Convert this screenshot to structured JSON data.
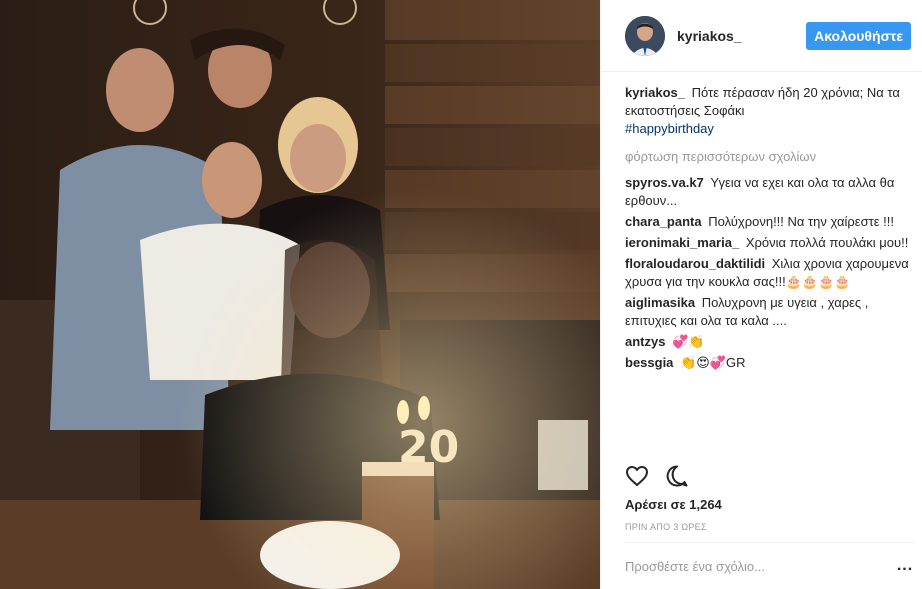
{
  "post": {
    "username": "kyriakos_",
    "follow_label": "Ακολουθήστε",
    "caption_user": "kyriakos_",
    "caption_text": "Πότε πέρασαν ήδη 20 χρόνια; Να τα εκατοστήσεις Σοφάκι",
    "caption_hashtag": "#happybirthday",
    "load_more": "φόρτωση περισσότερων σχολίων",
    "likes": "Αρέσει σε 1,264",
    "timestamp": "ΠΡΙΝ ΑΠΟ 3 ΩΡΕΣ",
    "comment_placeholder": "Προσθέστε ένα σχόλιο...",
    "more_label": "..."
  },
  "comments": [
    {
      "user": "spyros.va.k7",
      "text": "Υγεια να εχει και ολα τα αλλα θα ερθουν..."
    },
    {
      "user": "chara_panta",
      "text": "Πολύχρονη!!! Να την χαίρεστε !!!"
    },
    {
      "user": "ieronimaki_maria_",
      "text": "Χρόνια πολλά πουλάκι μου!!"
    },
    {
      "user": "floraloudarou_daktilidi",
      "text": "Χιλια χρονια χαρουμενα χρυσα για την κουκλα σας!!!🎂🎂🎂🎂"
    },
    {
      "user": "aiglimasika",
      "text": "Πολυχρονη με υγεια , χαρες , επιτυχιες και ολα τα καλα ...."
    },
    {
      "user": "antzys",
      "text": "💞👏"
    },
    {
      "user": "bessgia",
      "text": "👏😍💞GR"
    }
  ],
  "icons": {
    "like": "heart-icon",
    "comment": "comment-bubble-icon",
    "more": "more-options-icon"
  },
  "colors": {
    "accent": "#3897f0",
    "hashtag": "#003569",
    "muted": "#999999"
  }
}
